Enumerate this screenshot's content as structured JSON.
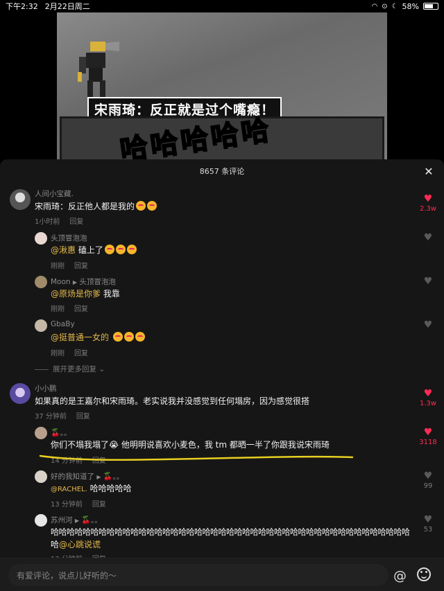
{
  "status": {
    "time": "下午2:32",
    "date": "2月22日周二",
    "battery": "58%",
    "battery_level": 0.58
  },
  "video": {
    "caption": "宋雨琦：反正就是过个嘴瘾！",
    "big_text": "哈哈哈哈哈"
  },
  "sheet": {
    "title": "8657 条评论"
  },
  "comments": [
    {
      "name": "人间小宝藏.",
      "text": "宋雨琦：反正他人都是我的",
      "time": "1小时前",
      "reply": "回复",
      "likes": "2.3w",
      "liked": true
    },
    {
      "name": "头顶冒泡泡",
      "mention": "@湫惠",
      "text": " 磕上了",
      "time": "刚刚",
      "reply": "回复"
    },
    {
      "name": "Moon",
      "reply_to": "头顶冒泡泡",
      "mention": "@原炀是你爹",
      "text": " 我靠",
      "time": "刚刚",
      "reply": "回复"
    },
    {
      "name": "GbaBy",
      "mention": "@挺普通一女的",
      "text": "",
      "time": "刚刚",
      "reply": "回复"
    },
    {
      "name": "小小鹏",
      "text": "如果真的是王嘉尔和宋雨琦。老实说我并没感觉到任何塌房，因为感觉很搭",
      "time": "37 分钟前",
      "reply": "回复",
      "likes": "1.3w",
      "liked": true
    },
    {
      "name": "。。",
      "text": "你们不塌我塌了😭 他明明说喜欢小麦色，我 tm 都晒一半了你跟我说宋雨琦",
      "time": "14 分钟前",
      "reply": "回复",
      "likes": "3118",
      "liked": true
    },
    {
      "name": "好的我知道了",
      "reply_to": "。。",
      "mention": "@RACHEL.",
      "text": " 哈哈哈哈哈",
      "time": "13 分钟前",
      "reply": "回复",
      "likes": "99"
    },
    {
      "name": "苏州河",
      "reply_to": "。。",
      "text": "哈哈哈哈哈哈哈哈哈哈哈哈哈哈哈哈哈哈哈哈哈哈哈哈哈哈哈哈哈哈哈哈哈哈哈哈哈哈哈哈哈哈哈哈哈哈哈哈哈哈哈哈哈哈哈哈",
      "text2": "哈",
      "mention2": "@心跳说谎",
      "time": "13 分钟前",
      "reply": "回复",
      "likes": "53"
    }
  ],
  "expand": "展开更多回复",
  "input": {
    "placeholder": "有爱评论，说点儿好听的～"
  },
  "colors": {
    "accent": "#fe2c55",
    "mention": "#e5b94a",
    "underline": "#e8d020"
  }
}
